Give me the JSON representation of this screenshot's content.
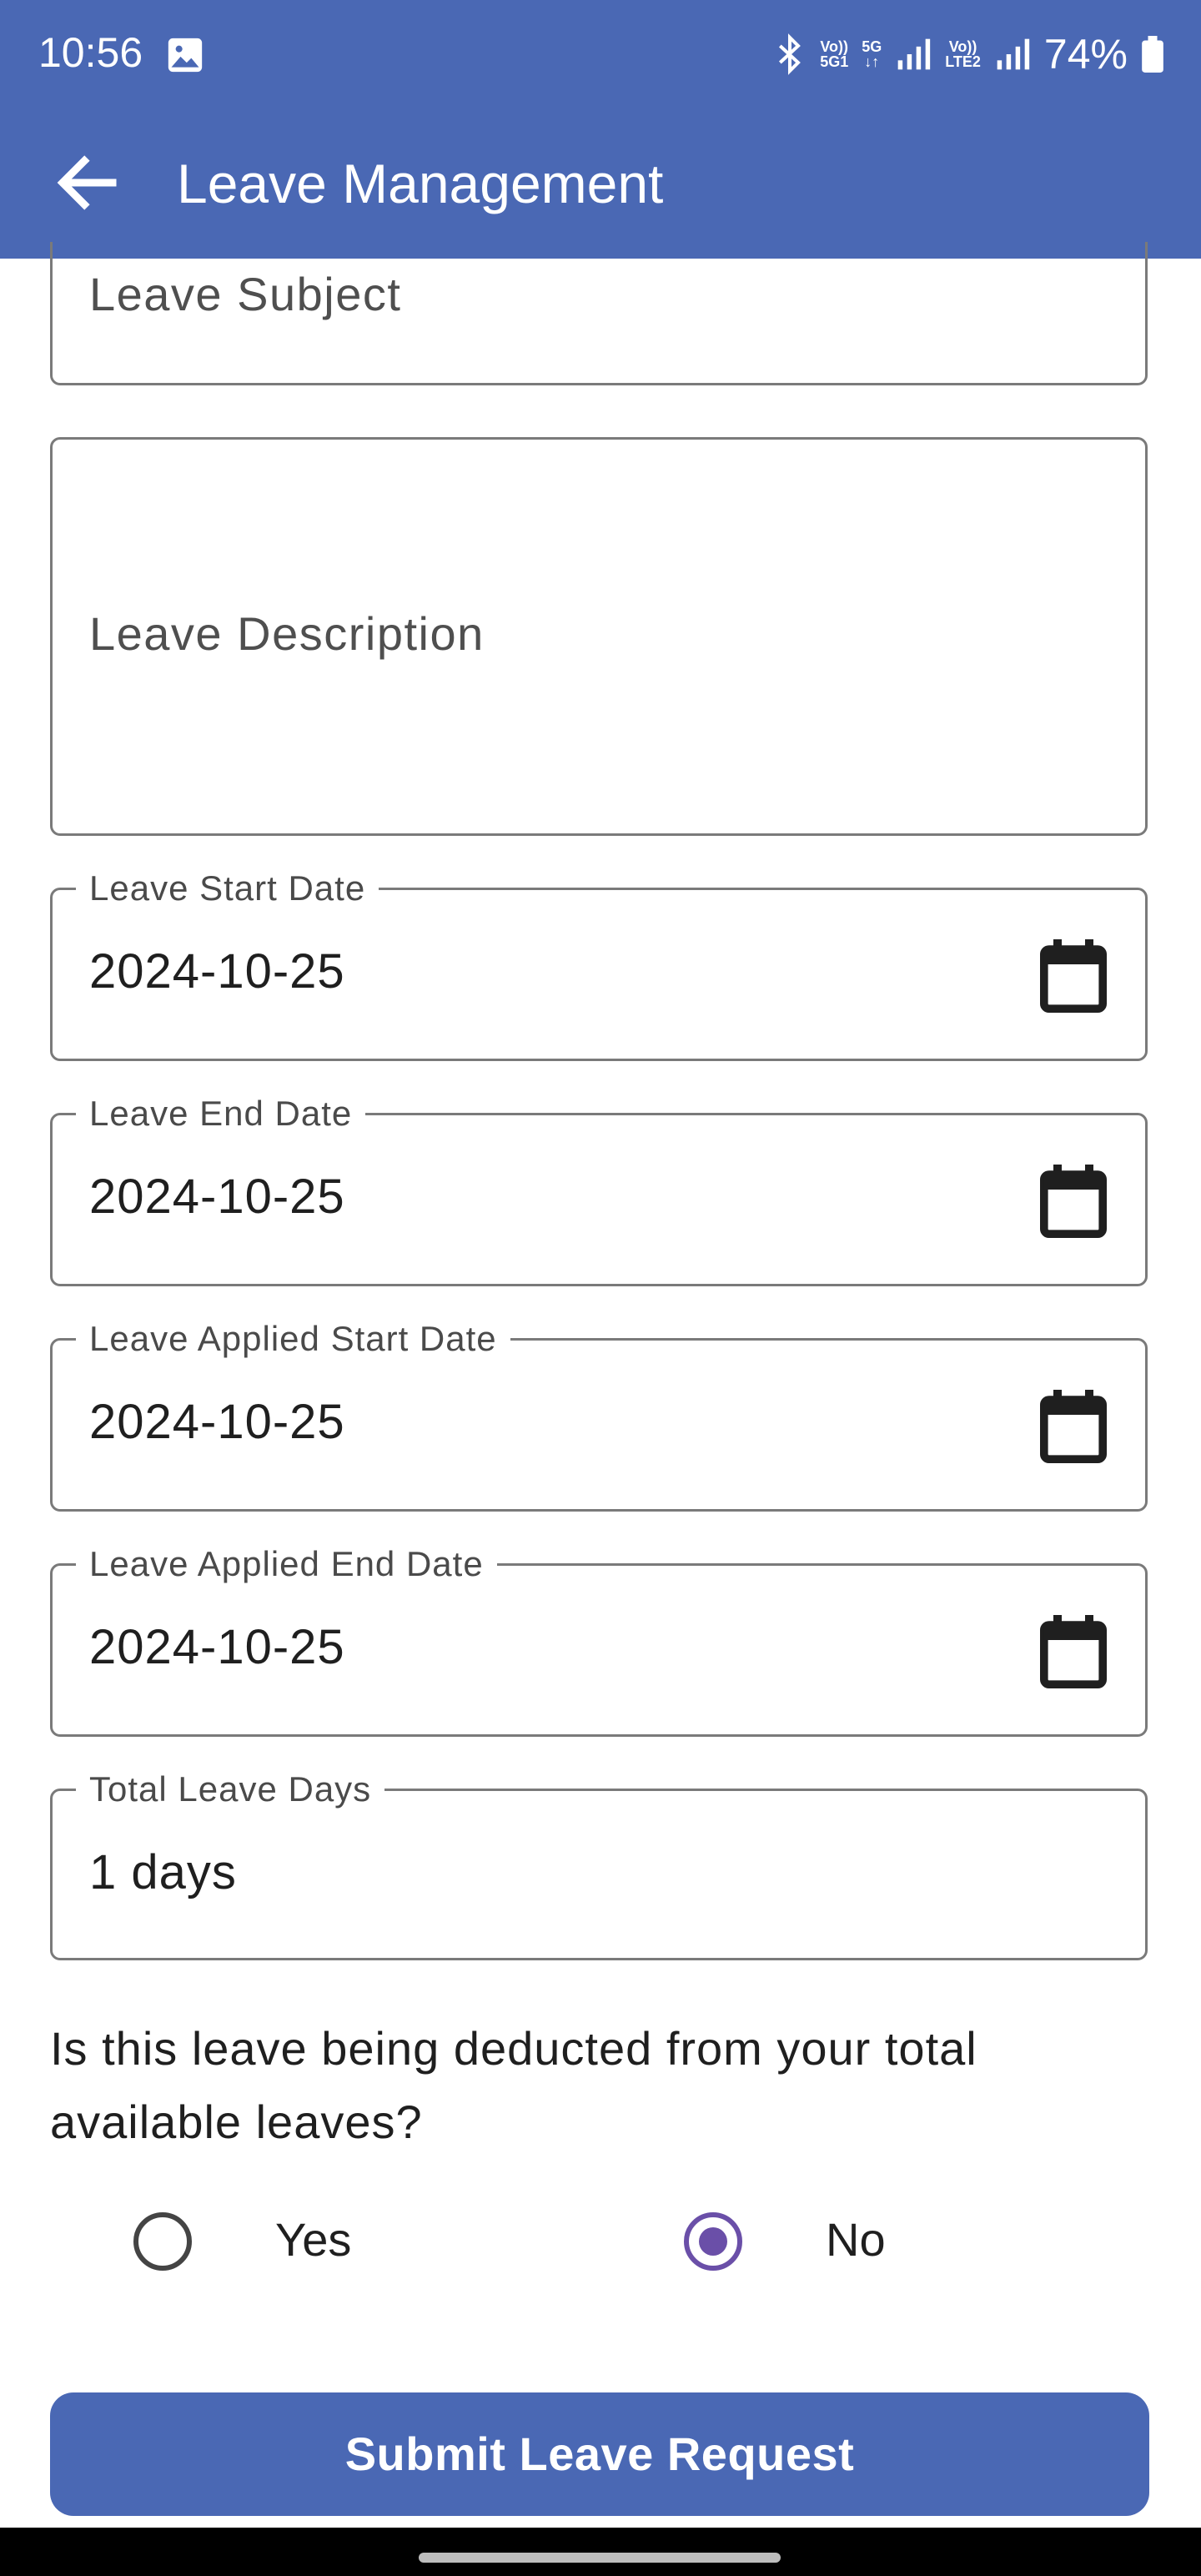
{
  "status_bar": {
    "time": "10:56",
    "battery": "74%",
    "icons": [
      "image-icon",
      "bluetooth-icon",
      "volte-5g-icon",
      "5g-data-icon",
      "signal-icon",
      "volte-lte2-icon",
      "signal-icon",
      "battery-icon"
    ],
    "net1_line1": "Vo))",
    "net1_line2": "5G1",
    "net2": "5G",
    "net3_line1": "Vo))",
    "net3_line2": "LTE2"
  },
  "app_bar": {
    "title": "Leave Management",
    "back_icon": "arrow-back-icon",
    "color": "#4a68b4"
  },
  "form": {
    "leave_subject": {
      "placeholder": "Leave Subject"
    },
    "leave_description": {
      "placeholder": "Leave Description"
    },
    "leave_start_date": {
      "label": "Leave Start Date",
      "value": "2024-10-25"
    },
    "leave_end_date": {
      "label": "Leave End Date",
      "value": "2024-10-25"
    },
    "leave_applied_start_date": {
      "label": "Leave Applied Start Date",
      "value": "2024-10-25"
    },
    "leave_applied_end_date": {
      "label": "Leave Applied End Date",
      "value": "2024-10-25"
    },
    "total_leave_days": {
      "label": "Total Leave Days",
      "value": "1 days"
    },
    "deduction_question": "Is this leave being deducted from your total available leaves?",
    "options": [
      {
        "label": "Yes",
        "selected": false
      },
      {
        "label": "No",
        "selected": true
      }
    ],
    "radio_selected_color": "#6a4fa8",
    "submit_label": "Submit Leave Request"
  }
}
